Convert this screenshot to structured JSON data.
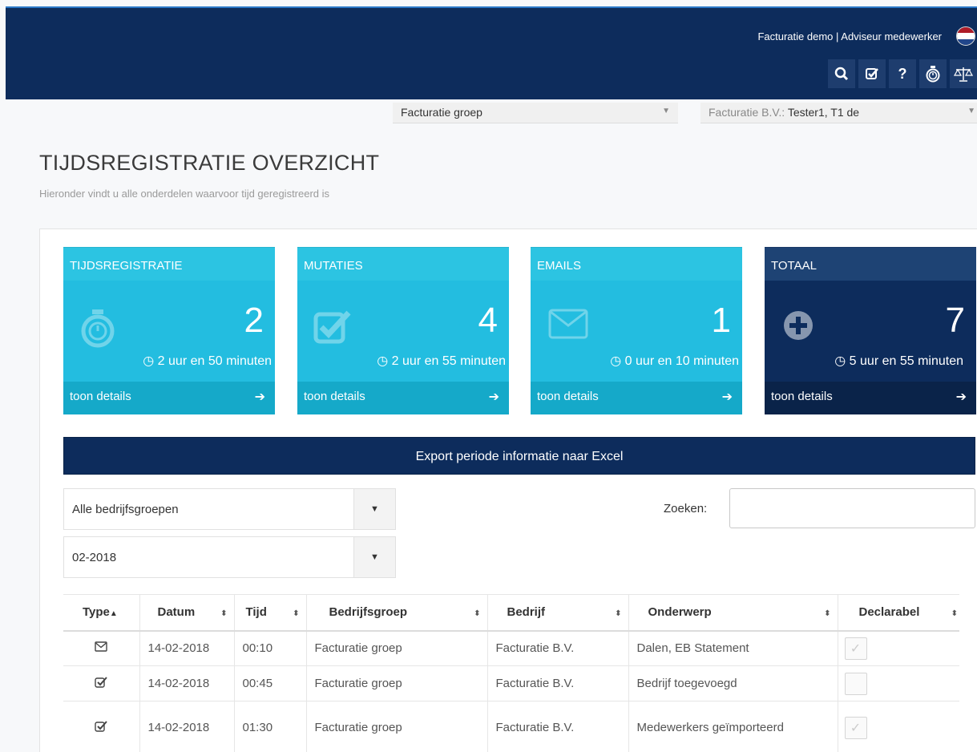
{
  "header": {
    "user_text": "Facturatie demo | Adviseur medewerker",
    "flag_colors": [
      "#ae1c28",
      "#ffffff",
      "#21468b"
    ],
    "toolbar_icons": [
      "search-icon",
      "check-square-icon",
      "help-icon",
      "stopwatch-icon",
      "balance-scale-icon"
    ]
  },
  "selectors": {
    "group": {
      "value": "Facturatie groep"
    },
    "company": {
      "prefix": "Facturatie B.V.:",
      "value": "Tester1, T1 de"
    }
  },
  "page": {
    "title": "TIJDSREGISTRATIE OVERZICHT",
    "subtitle": "Hieronder vindt u alle onderdelen waarvoor tijd geregistreerd is"
  },
  "cards": [
    {
      "label": "TIJDSREGISTRATIE",
      "count": "2",
      "time": "2 uur en 50 minuten",
      "link": "toon details",
      "icon": "stopwatch-icon"
    },
    {
      "label": "MUTATIES",
      "count": "4",
      "time": "2 uur en 55 minuten",
      "link": "toon details",
      "icon": "check-square-icon"
    },
    {
      "label": "EMAILS",
      "count": "1",
      "time": "0 uur en 10 minuten",
      "link": "toon details",
      "icon": "envelope-icon"
    },
    {
      "label": "TOTAAL",
      "count": "7",
      "time": "5 uur en 55 minuten",
      "link": "toon details",
      "icon": "plus-circle-icon"
    }
  ],
  "export_label": "Export periode informatie naar Excel",
  "filters": {
    "group": "Alle bedrijfsgroepen",
    "period": "02-2018"
  },
  "search": {
    "label": "Zoeken:",
    "value": ""
  },
  "table": {
    "columns": [
      "Type",
      "Datum",
      "Tijd",
      "Bedrijfsgroep",
      "Bedrijf",
      "Onderwerp",
      "Declarabel"
    ],
    "rows": [
      {
        "type": "envelope-icon",
        "datum": "14-02-2018",
        "tijd": "00:10",
        "bedrijfsgroep": "Facturatie groep",
        "bedrijf": "Facturatie B.V.",
        "onderwerp": "Dalen, EB Statement",
        "declarabel": true
      },
      {
        "type": "check-square-icon",
        "datum": "14-02-2018",
        "tijd": "00:45",
        "bedrijfsgroep": "Facturatie groep",
        "bedrijf": "Facturatie B.V.",
        "onderwerp": "Bedrijf toegevoegd",
        "declarabel": false
      },
      {
        "type": "check-square-icon",
        "datum": "14-02-2018",
        "tijd": "01:30",
        "bedrijfsgroep": "Facturatie groep",
        "bedrijf": "Facturatie B.V.",
        "onderwerp": "Medewerkers geïmporteerd",
        "declarabel": true
      }
    ]
  }
}
